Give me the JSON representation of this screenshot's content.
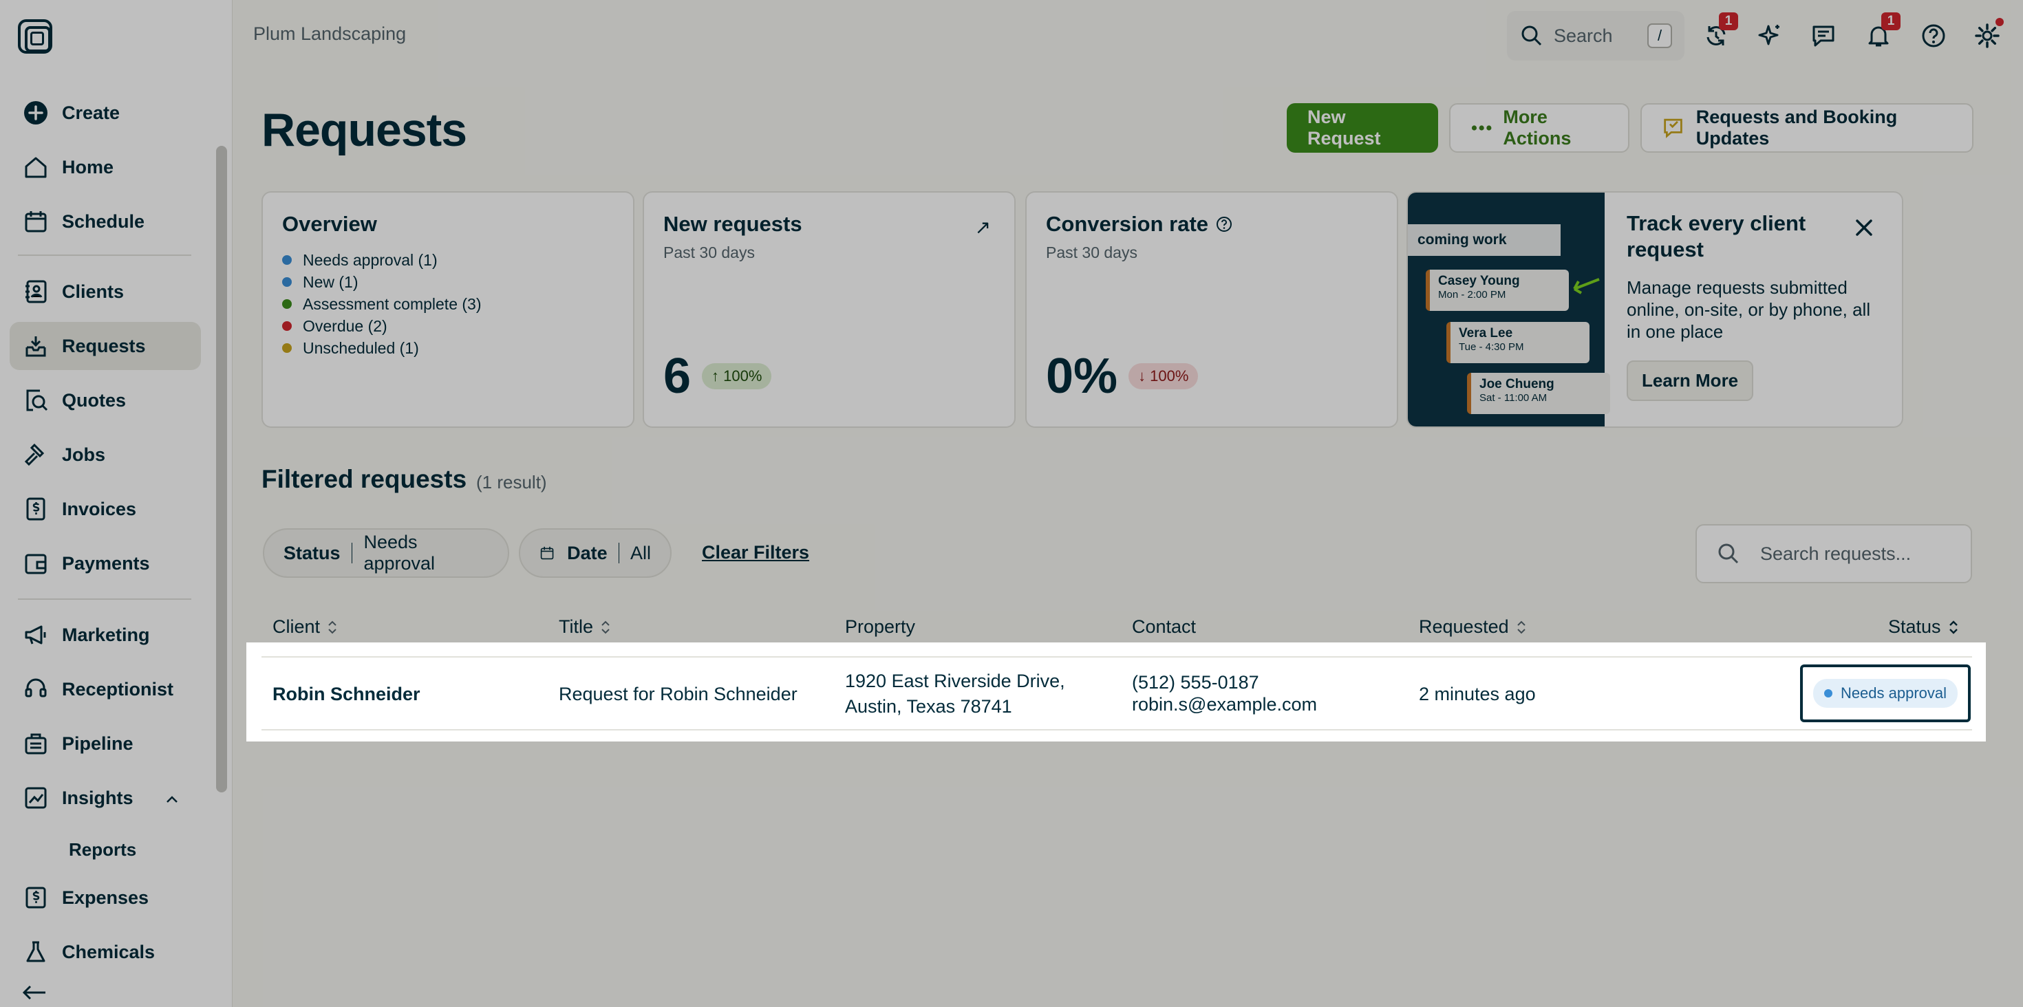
{
  "company": "Plum Landscaping",
  "top_bar": {
    "search_placeholder": "Search",
    "search_shortcut": "/",
    "sync_badge": "1",
    "notifications_badge": "1"
  },
  "sidebar": {
    "items": [
      {
        "label": "Create",
        "icon": "plus-circle-icon"
      },
      {
        "label": "Home",
        "icon": "home-icon"
      },
      {
        "label": "Schedule",
        "icon": "calendar-icon"
      },
      {
        "label": "Clients",
        "icon": "clients-icon"
      },
      {
        "label": "Requests",
        "icon": "requests-icon",
        "active": true
      },
      {
        "label": "Quotes",
        "icon": "quotes-icon"
      },
      {
        "label": "Jobs",
        "icon": "hammer-icon"
      },
      {
        "label": "Invoices",
        "icon": "invoice-icon"
      },
      {
        "label": "Payments",
        "icon": "wallet-icon"
      },
      {
        "label": "Marketing",
        "icon": "megaphone-icon"
      },
      {
        "label": "Receptionist",
        "icon": "phone-icon"
      },
      {
        "label": "Pipeline",
        "icon": "pipeline-icon"
      },
      {
        "label": "Insights",
        "icon": "chart-icon"
      },
      {
        "label": "Reports"
      },
      {
        "label": "Expenses",
        "icon": "expense-icon"
      },
      {
        "label": "Chemicals",
        "icon": "flask-icon"
      }
    ]
  },
  "header": {
    "title": "Requests",
    "new_request": "New Request",
    "more_actions": "More Actions",
    "updates": "Requests and Booking Updates"
  },
  "overview": {
    "title": "Overview",
    "items": [
      {
        "label": "Needs approval (1)",
        "color": "#3a8ed6"
      },
      {
        "label": "New (1)",
        "color": "#3a8ed6"
      },
      {
        "label": "Assessment complete (3)",
        "color": "#3b8c1b"
      },
      {
        "label": "Overdue (2)",
        "color": "#d1262e"
      },
      {
        "label": "Unscheduled (1)",
        "color": "#c7a31e"
      }
    ]
  },
  "new_requests": {
    "title": "New requests",
    "period": "Past 30 days",
    "value": "6",
    "change": "↑ 100%"
  },
  "conversion": {
    "title": "Conversion rate",
    "period": "Past 30 days",
    "value": "0%",
    "change": "↓ 100%"
  },
  "promo": {
    "art_header": "coming work",
    "tickets": [
      {
        "name": "Casey Young",
        "time": "Mon - 2:00 PM"
      },
      {
        "name": "Vera Lee",
        "time": "Tue - 4:30 PM"
      },
      {
        "name": "Joe Chueng",
        "time": "Sat - 11:00 AM"
      }
    ],
    "title": "Track every client request",
    "text": "Manage requests submitted online, on-site, or by phone, all in one place",
    "button": "Learn More"
  },
  "filtered": {
    "title": "Filtered requests",
    "count": "(1 result)",
    "status_label": "Status",
    "status_value": "Needs approval",
    "date_label": "Date",
    "date_value": "All",
    "clear": "Clear Filters",
    "search_placeholder": "Search requests..."
  },
  "table": {
    "columns": [
      "Client",
      "Title",
      "Property",
      "Contact",
      "Requested",
      "Status"
    ],
    "rows": [
      {
        "client": "Robin Schneider",
        "title": "Request for Robin Schneider",
        "property_line1": "1920 East Riverside Drive,",
        "property_line2": "Austin, Texas 78741",
        "phone": "(512) 555-0187",
        "email": "robin.s@example.com",
        "requested": "2 minutes ago",
        "status": "Needs approval"
      }
    ]
  }
}
